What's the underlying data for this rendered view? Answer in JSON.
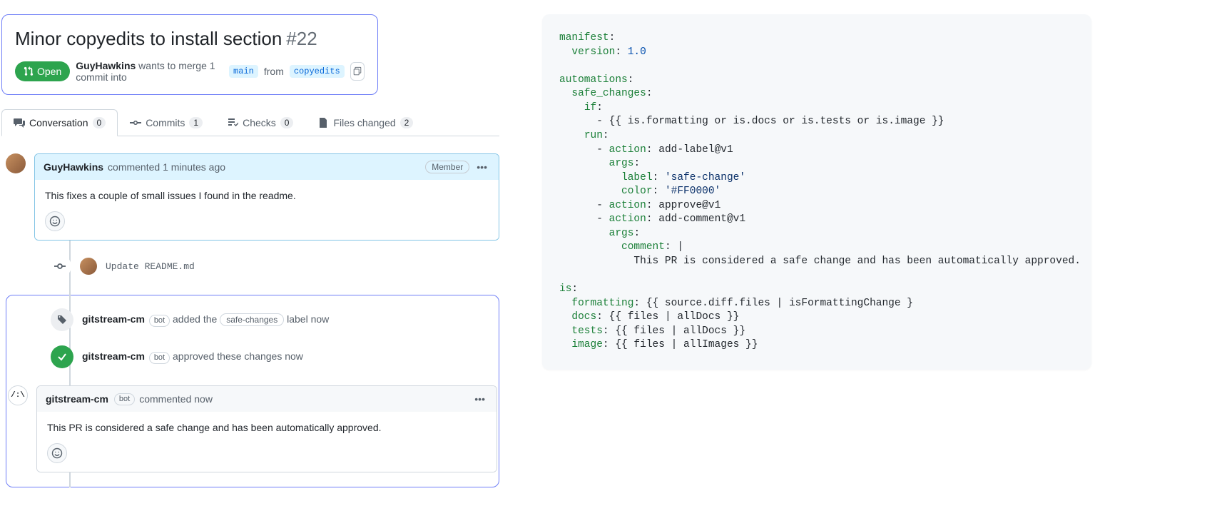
{
  "pr": {
    "title": "Minor copyedits to install section",
    "number": "#22",
    "state": "Open",
    "author": "GuyHawkins",
    "merge_text_1": "wants to merge 1 commit into",
    "base_branch": "main",
    "merge_text_2": "from",
    "head_branch": "copyedits"
  },
  "tabs": {
    "conversation": {
      "label": "Conversation",
      "count": "0"
    },
    "commits": {
      "label": "Commits",
      "count": "1"
    },
    "checks": {
      "label": "Checks",
      "count": "0"
    },
    "files": {
      "label": "Files changed",
      "count": "2"
    }
  },
  "comment1": {
    "author": "GuyHawkins",
    "action": "commented 1 minutes ago",
    "role": "Member",
    "body": "This fixes a couple of small issues I found in the readme."
  },
  "commit_event": {
    "message": "Update README.md"
  },
  "label_event": {
    "actor": "gitstream-cm",
    "bot": "bot",
    "text1": "added the",
    "label": "safe-changes",
    "text2": "label now"
  },
  "approve_event": {
    "actor": "gitstream-cm",
    "bot": "bot",
    "text": "approved these changes now"
  },
  "comment2": {
    "author": "gitstream-cm",
    "bot": "bot",
    "action": "commented now",
    "body": "This PR is considered a safe change and has been automatically approved."
  },
  "code": {
    "l1_k": "manifest",
    "l1_p": ":",
    "l2_k": "version",
    "l2_p": ": ",
    "l2_v": "1.0",
    "l3_k": "automations",
    "l3_p": ":",
    "l4_k": "safe_changes",
    "l4_p": ":",
    "l5_k": "if",
    "l5_p": ":",
    "l6_p": "- ",
    "l6_v": "{{ is.formatting or is.docs or is.tests or is.image }}",
    "l7_k": "run",
    "l7_p": ":",
    "l8_p": "- ",
    "l8_k": "action",
    "l8_p2": ": ",
    "l8_v": "add-label@v1",
    "l9_k": "args",
    "l9_p": ":",
    "l10_k": "label",
    "l10_p": ": ",
    "l10_v": "'safe-change'",
    "l11_k": "color",
    "l11_p": ": ",
    "l11_v": "'#FF0000'",
    "l12_p": "- ",
    "l12_k": "action",
    "l12_p2": ": ",
    "l12_v": "approve@v1",
    "l13_p": "- ",
    "l13_k": "action",
    "l13_p2": ": ",
    "l13_v": "add-comment@v1",
    "l14_k": "args",
    "l14_p": ":",
    "l15_k": "comment",
    "l15_p": ": ",
    "l15_v": "|",
    "l16_v": "This PR is considered a safe change and has been automatically approved.",
    "l17_k": "is",
    "l17_p": ":",
    "l18_k": "formatting",
    "l18_p": ": ",
    "l18_v": "{{ source.diff.files | isFormattingChange }",
    "l19_k": "docs",
    "l19_p": ": ",
    "l19_v": "{{ files | allDocs }}",
    "l20_k": "tests",
    "l20_p": ": ",
    "l20_v": "{{ files | allDocs }}",
    "l21_k": "image",
    "l21_p": ": ",
    "l21_v": "{{ files | allImages }}"
  }
}
